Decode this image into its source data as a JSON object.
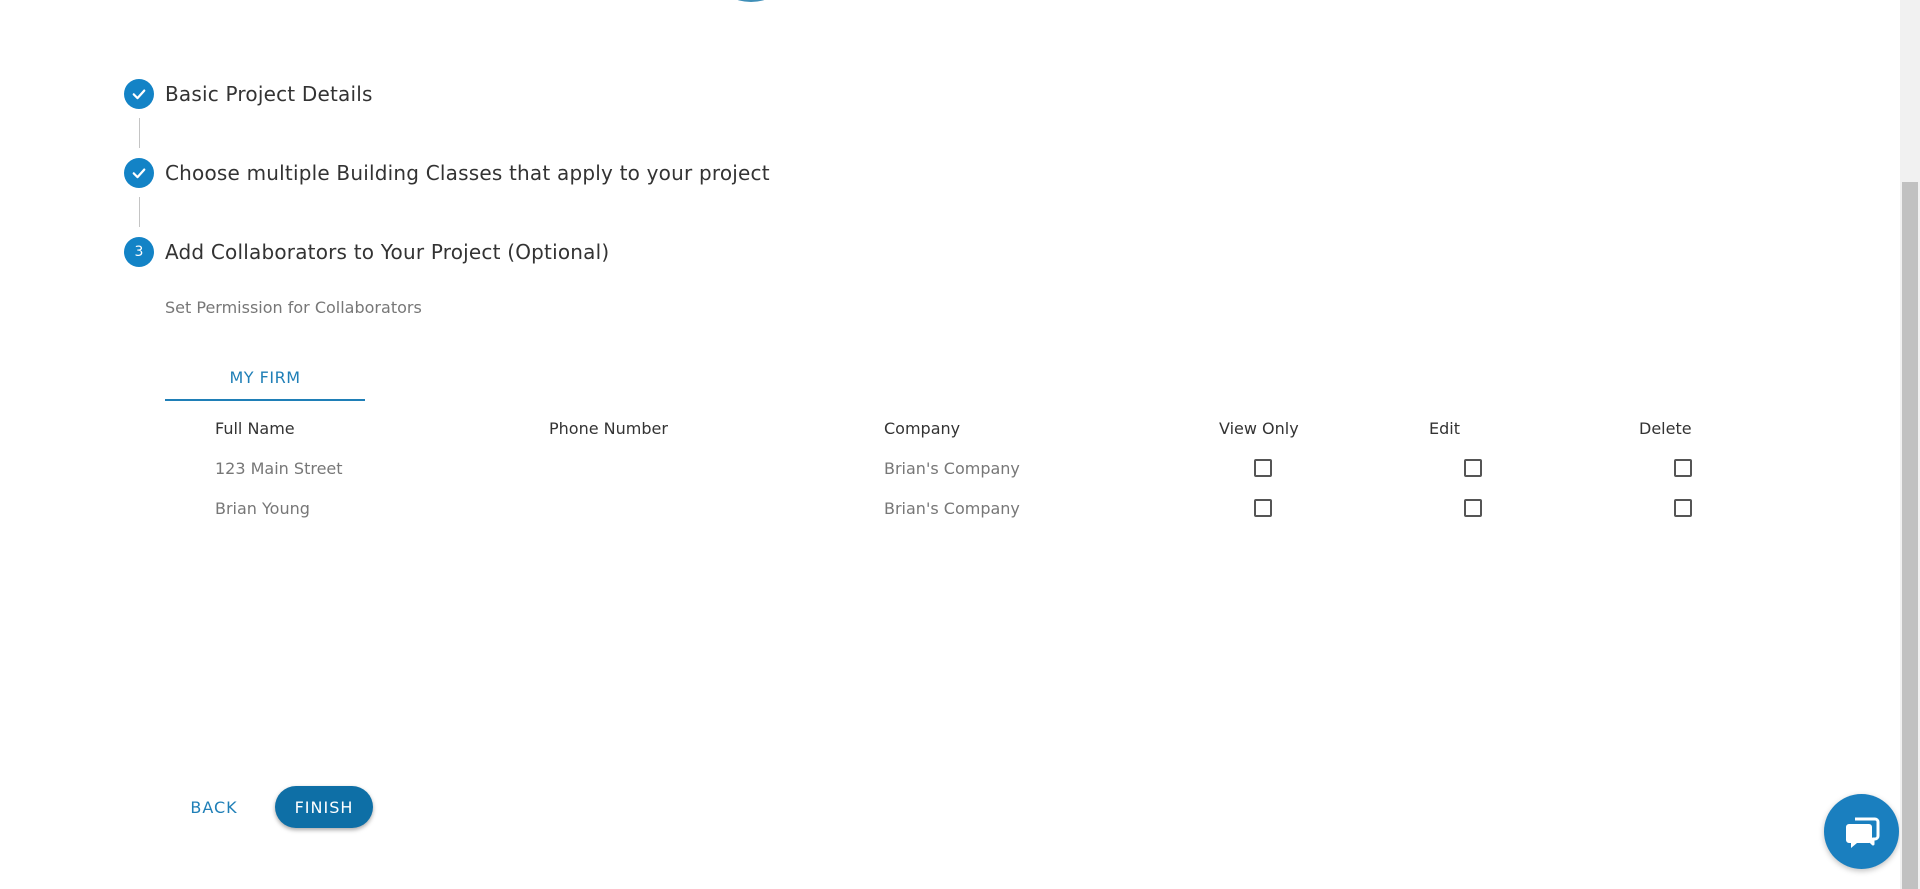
{
  "stepper": {
    "steps": [
      {
        "label": "Basic Project Details",
        "status": "completed",
        "icon": "check-icon"
      },
      {
        "label": "Choose multiple Building Classes that apply to your project",
        "status": "completed",
        "icon": "check-icon"
      },
      {
        "label": "Add Collaborators to Your Project (Optional)",
        "status": "active",
        "number": "3"
      }
    ]
  },
  "subtitle": "Set Permission for Collaborators",
  "tabs": [
    {
      "label": "MY FIRM",
      "active": true
    }
  ],
  "table": {
    "headers": {
      "full_name": "Full Name",
      "phone": "Phone Number",
      "company": "Company",
      "view_only": "View Only",
      "edit": "Edit",
      "delete": "Delete"
    },
    "rows": [
      {
        "full_name": "123 Main Street",
        "phone": "",
        "company": "Brian's Company",
        "view_only": false,
        "edit": false,
        "delete": false
      },
      {
        "full_name": "Brian Young",
        "phone": "",
        "company": "Brian's Company",
        "view_only": false,
        "edit": false,
        "delete": false
      }
    ]
  },
  "actions": {
    "back_label": "BACK",
    "finish_label": "FINISH"
  },
  "chat": {
    "icon": "chat-bubble-icon"
  },
  "colors": {
    "accent": "#1383c6",
    "link": "#1f7fb7",
    "finish_bg": "#0e6fa6"
  }
}
